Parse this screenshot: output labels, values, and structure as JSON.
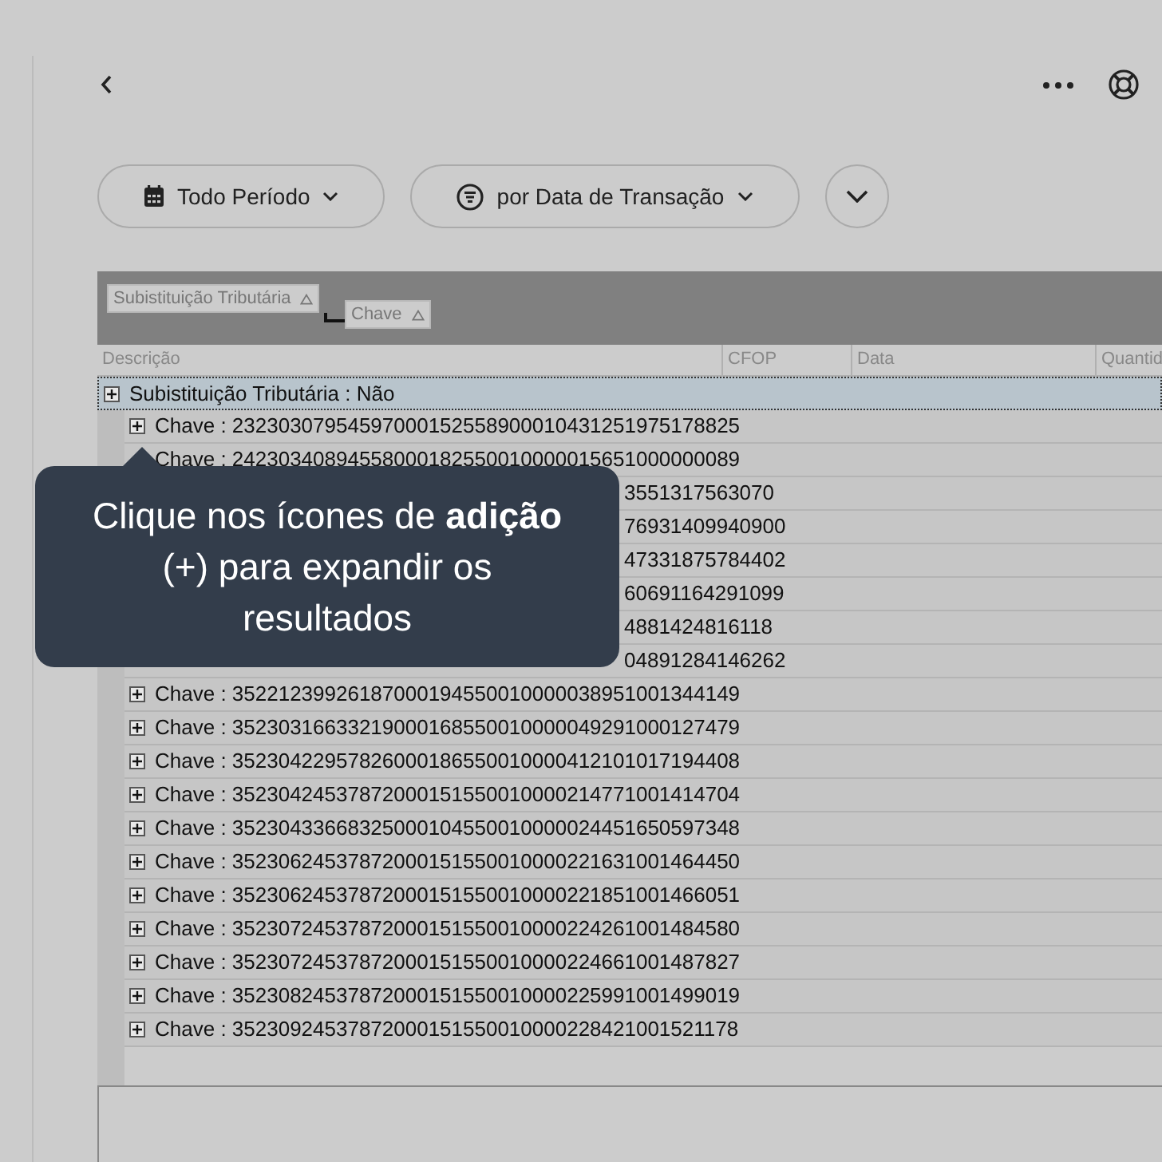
{
  "filters": [
    {
      "kind": "calendar",
      "label": "Todo Período"
    },
    {
      "kind": "filter",
      "label": "por Data de Transação"
    }
  ],
  "grid": {
    "group_chips": [
      "Subistituição Tributária",
      "Chave"
    ],
    "columns": [
      "Descrição",
      "CFOP",
      "Data",
      "Quantid"
    ],
    "group_row": {
      "text": "Subistituição Tributária : Não",
      "expanded": false
    },
    "rows": [
      {
        "kind": "key",
        "text": "Chave : 23230307954597000152558900010431251975178825"
      },
      {
        "kind": "text_only",
        "text": "Chave : 24230340894558000182550010000015651000000089"
      },
      {
        "kind": "tail",
        "text": "3551317563070"
      },
      {
        "kind": "tail",
        "text": "76931409940900"
      },
      {
        "kind": "tail",
        "text": "47331875784402"
      },
      {
        "kind": "tail",
        "text": "60691164291099"
      },
      {
        "kind": "tail",
        "text": "4881424816118"
      },
      {
        "kind": "tail",
        "text": "04891284146262"
      },
      {
        "kind": "key",
        "text": "Chave : 35221239926187000194550010000038951001344149"
      },
      {
        "kind": "key",
        "text": "Chave : 35230316633219000168550010000049291000127479"
      },
      {
        "kind": "key",
        "text": "Chave : 35230422957826000186550010000412101017194408"
      },
      {
        "kind": "key",
        "text": "Chave : 35230424537872000151550010000214771001414704"
      },
      {
        "kind": "key",
        "text": "Chave : 35230433668325000104550010000024451650597348"
      },
      {
        "kind": "key",
        "text": "Chave : 35230624537872000151550010000221631001464450"
      },
      {
        "kind": "key",
        "text": "Chave : 35230624537872000151550010000221851001466051"
      },
      {
        "kind": "key",
        "text": "Chave : 35230724537872000151550010000224261001484580"
      },
      {
        "kind": "key",
        "text": "Chave : 35230724537872000151550010000224661001487827"
      },
      {
        "kind": "key",
        "text": "Chave : 35230824537872000151550010000225991001499019"
      },
      {
        "kind": "key",
        "text": "Chave : 35230924537872000151550010000228421001521178"
      }
    ]
  },
  "tooltip": {
    "text": "Clique nos ícones de **adição** (+) para expandir os resultados"
  }
}
